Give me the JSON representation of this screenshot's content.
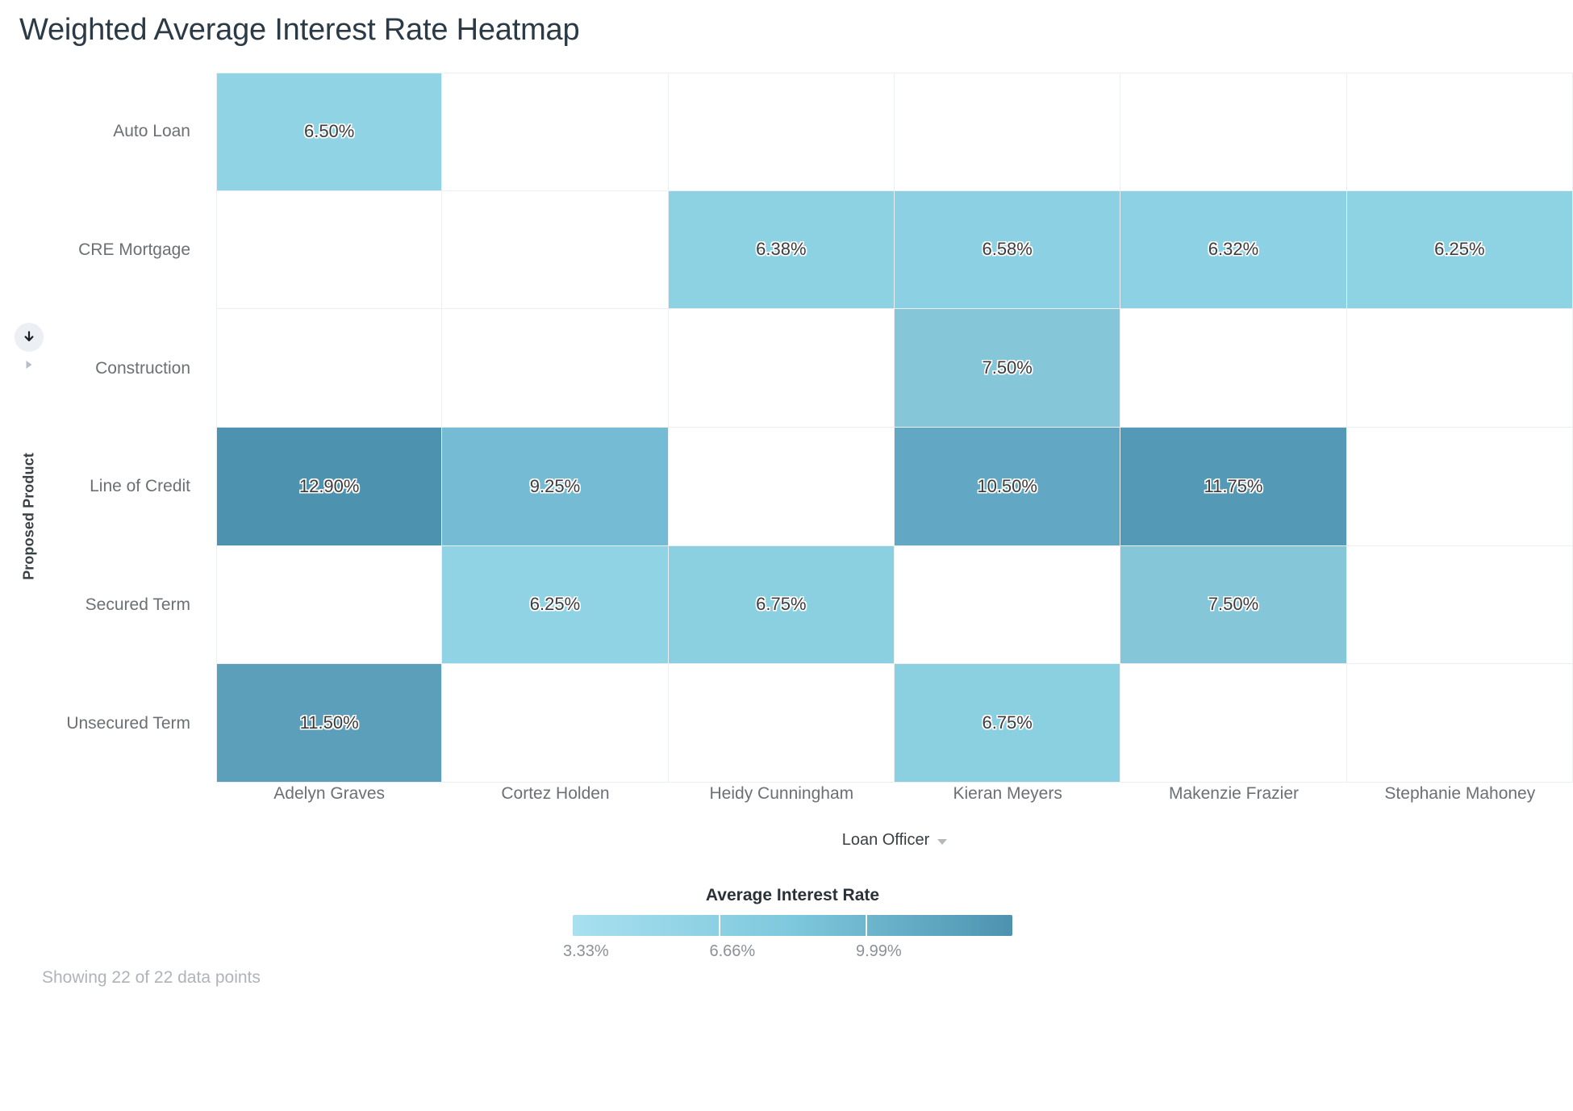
{
  "chart": {
    "title": "Weighted Average Interest Rate Heatmap"
  },
  "axes": {
    "y_title": "Proposed Product",
    "x_title": "Loan Officer",
    "y_sort_icon": "arrow-down-icon",
    "y_expand_icon": "caret-right-icon",
    "x_dropdown_icon": "caret-down-icon"
  },
  "legend": {
    "title": "Average Interest Rate",
    "ticks": [
      "3.33%",
      "6.66%",
      "9.99%"
    ],
    "tick_positions": [
      0.0,
      0.333,
      0.666
    ],
    "gradient_start": "#a8e0ef",
    "gradient_mid": "#7ec8dd",
    "gradient_end": "#4d93b0"
  },
  "footer": {
    "data_points_note": "Showing 22 of 22 data points"
  },
  "chart_data": {
    "type": "heatmap",
    "title": "Weighted Average Interest Rate Heatmap",
    "xlabel": "Loan Officer",
    "ylabel": "Proposed Product",
    "value_format": "percent",
    "colorbar_label": "Average Interest Rate",
    "colorbar_ticks": [
      3.33,
      6.66,
      9.99
    ],
    "color_scale_min": 0,
    "color_scale_max": 13.32,
    "columns": [
      "Adelyn Graves",
      "Cortez Holden",
      "Heidy Cunningham",
      "Kieran Meyers",
      "Makenzie Frazier",
      "Stephanie Mahoney"
    ],
    "rows": [
      "Auto Loan",
      "CRE Mortgage",
      "Construction",
      "Line of Credit",
      "Secured Term",
      "Unsecured Term"
    ],
    "values": [
      [
        6.5,
        null,
        null,
        null,
        null,
        null
      ],
      [
        null,
        null,
        6.38,
        6.58,
        6.32,
        6.25
      ],
      [
        null,
        null,
        null,
        7.5,
        null,
        null
      ],
      [
        12.9,
        9.25,
        null,
        10.5,
        11.75,
        null
      ],
      [
        null,
        6.25,
        6.75,
        null,
        7.5,
        null
      ],
      [
        11.5,
        null,
        null,
        6.75,
        null,
        null
      ]
    ],
    "labels": [
      [
        "6.50%",
        "",
        "",
        "",
        "",
        ""
      ],
      [
        "",
        "",
        "6.38%",
        "6.58%",
        "6.32%",
        "6.25%"
      ],
      [
        "",
        "",
        "",
        "7.50%",
        "",
        ""
      ],
      [
        "12.90%",
        "9.25%",
        "",
        "10.50%",
        "11.75%",
        ""
      ],
      [
        "",
        "6.25%",
        "6.75%",
        "",
        "7.50%",
        ""
      ],
      [
        "11.50%",
        "",
        "",
        "6.75%",
        "",
        ""
      ]
    ],
    "cell_colors": [
      [
        "#8fd3e4",
        null,
        null,
        null,
        null,
        null
      ],
      [
        null,
        null,
        "#8dd2e3",
        "#8cd1e3",
        "#8dd2e4",
        "#8ed3e4"
      ],
      [
        null,
        null,
        null,
        "#85c6d9",
        null,
        null
      ],
      [
        "#4d93b0",
        "#74bbd3",
        null,
        "#62a8c4",
        "#5499b5",
        null
      ],
      [
        null,
        "#8fd3e4",
        "#8ad0e1",
        null,
        "#85c6d9",
        null
      ],
      [
        "#5b9fba",
        null,
        null,
        "#8ad0e1",
        null,
        null
      ]
    ]
  }
}
